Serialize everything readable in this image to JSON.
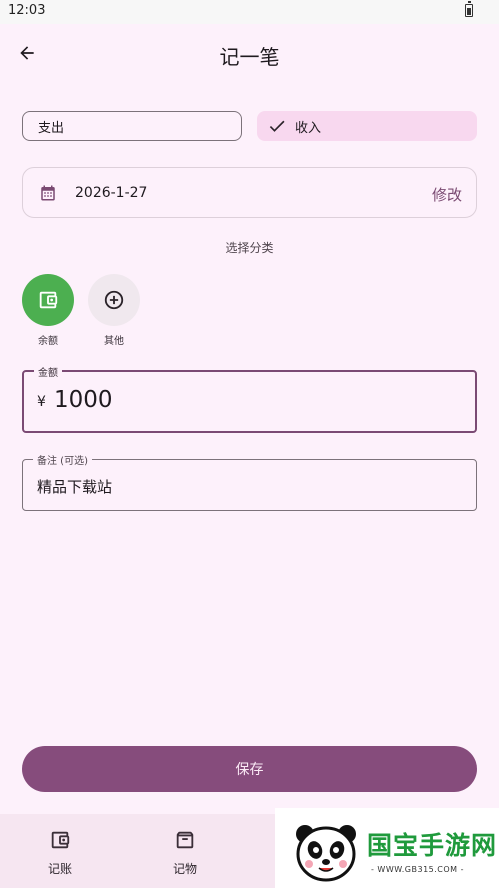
{
  "status_bar": {
    "time": "12:03"
  },
  "app_bar": {
    "title": "记一笔"
  },
  "type_toggle": {
    "expense_label": "支出",
    "income_label": "收入",
    "selected": "income"
  },
  "date": {
    "value": "2026-1-27",
    "edit_label": "修改"
  },
  "category": {
    "section_label": "选择分类",
    "items": [
      {
        "label": "余额",
        "icon": "wallet-icon",
        "color": "#4caf50"
      },
      {
        "label": "其他",
        "icon": "add-circle-icon",
        "color": "#f0e8ee"
      }
    ]
  },
  "amount": {
    "label": "金额",
    "currency": "¥",
    "value": "1000"
  },
  "note": {
    "label": "备注 (可选)",
    "value": "精品下载站"
  },
  "save_label": "保存",
  "bottom_nav": {
    "items": [
      {
        "label": "记账",
        "icon": "wallet-icon"
      },
      {
        "label": "记物",
        "icon": "archive-icon"
      }
    ]
  },
  "watermark": {
    "text": "国宝手游网",
    "url": "- WWW.GB315.COM -"
  },
  "colors": {
    "primary": "#864c7c",
    "background": "#fdf1fb",
    "accent_green": "#4caf50"
  }
}
